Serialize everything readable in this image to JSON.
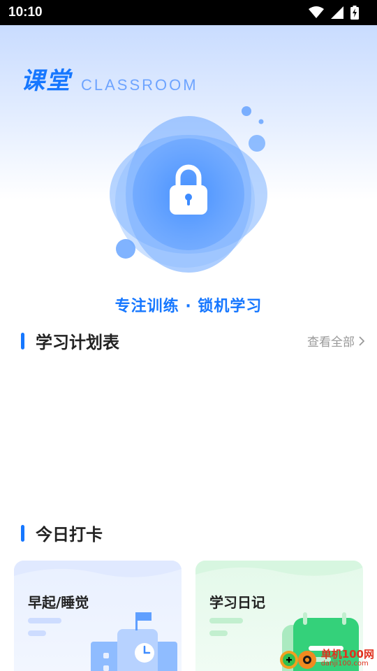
{
  "status_bar": {
    "time": "10:10",
    "icons": [
      "wifi-icon",
      "signal-icon",
      "battery-charging-icon"
    ]
  },
  "header": {
    "title_cn": "课堂",
    "title_en": "CLASSROOM"
  },
  "hero": {
    "icon": "lock-icon",
    "tagline": "专注训练 · 锁机学习"
  },
  "study_plan": {
    "title": "学习计划表",
    "view_all": "查看全部",
    "view_all_icon": "chevron-right-icon"
  },
  "checkin": {
    "title": "今日打卡",
    "cards": [
      {
        "label": "早起/睡觉",
        "icon": "school-clock-icon"
      },
      {
        "label": "学习日记",
        "icon": "notebook-icon"
      }
    ]
  },
  "watermark": {
    "text": "单机100网",
    "sub": "danji100.com"
  },
  "colors": {
    "accent": "#1677ff",
    "text_primary": "#222222",
    "text_muted": "#999999",
    "card_blue": "#e9f0ff",
    "card_green": "#e4f9ea"
  }
}
